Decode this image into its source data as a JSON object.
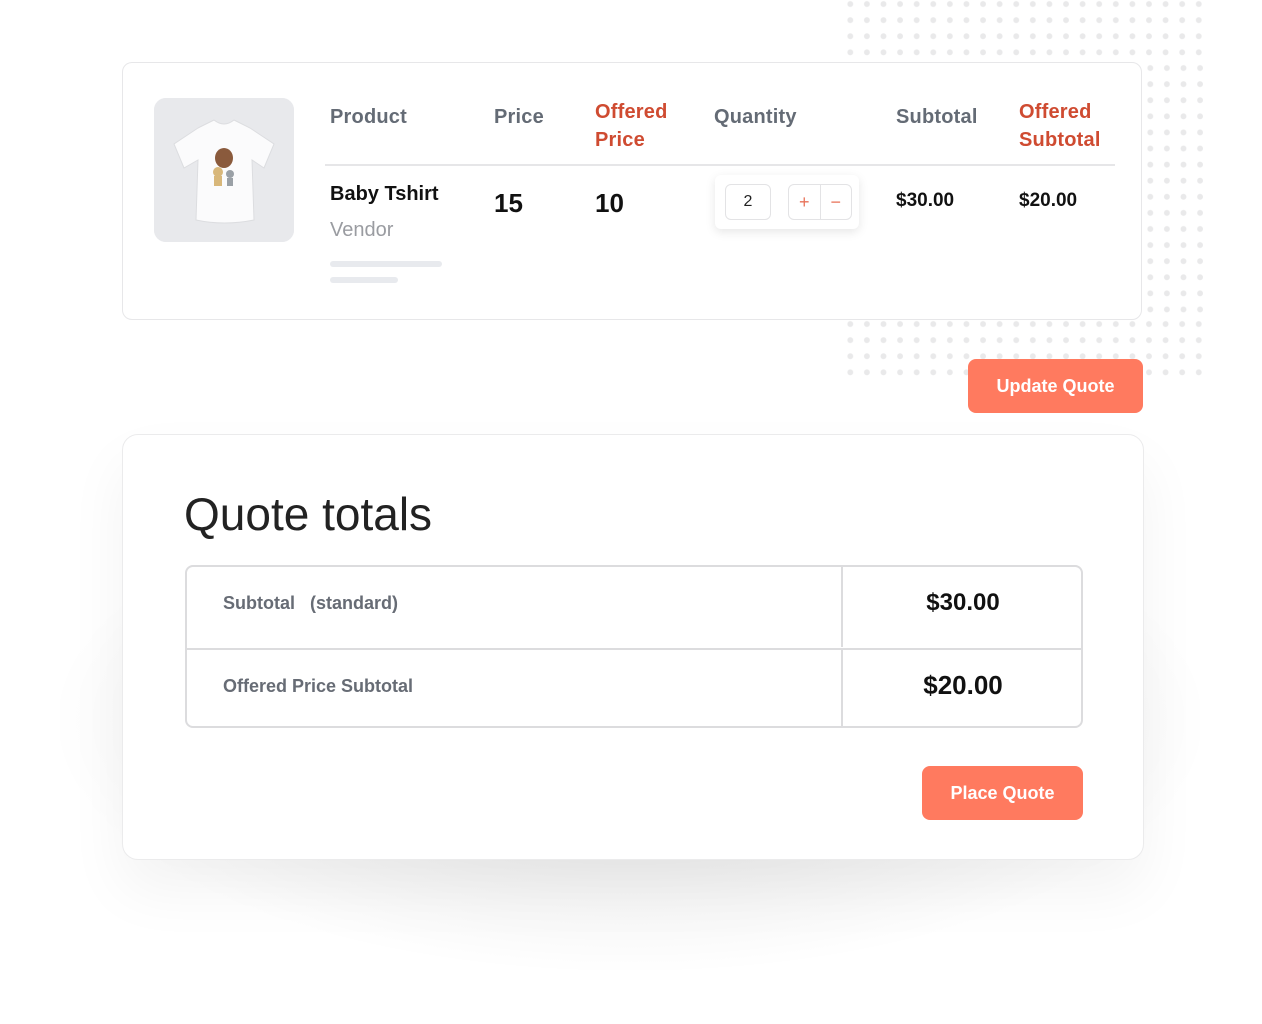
{
  "product_table": {
    "headers": {
      "product": "Product",
      "price": "Price",
      "offered_price": [
        "Offered",
        "Price"
      ],
      "quantity": "Quantity",
      "subtotal": "Subtotal",
      "offered_subtotal": [
        "Offered",
        "Subtotal"
      ]
    },
    "row": {
      "image_alt": "Baby Tshirt product image",
      "name": "Baby Tshirt",
      "vendor": "Vendor",
      "price": "15",
      "offered_price": "10",
      "quantity": "2",
      "subtotal": "$30.00",
      "offered_subtotal": "$20.00"
    },
    "qty_controls": {
      "plus": "+",
      "minus": "−"
    }
  },
  "update_button": "Update Quote",
  "totals": {
    "title": "Quote totals",
    "rows": [
      {
        "label": "Subtotal   (standard)",
        "value": "$30.00"
      },
      {
        "label": "Offered Price Subtotal",
        "value": "$20.00"
      }
    ],
    "place_button": "Place Quote"
  },
  "colors": {
    "accent": "#ff7a5f",
    "accent_text": "#cf4b31",
    "header_text": "#646b75"
  }
}
